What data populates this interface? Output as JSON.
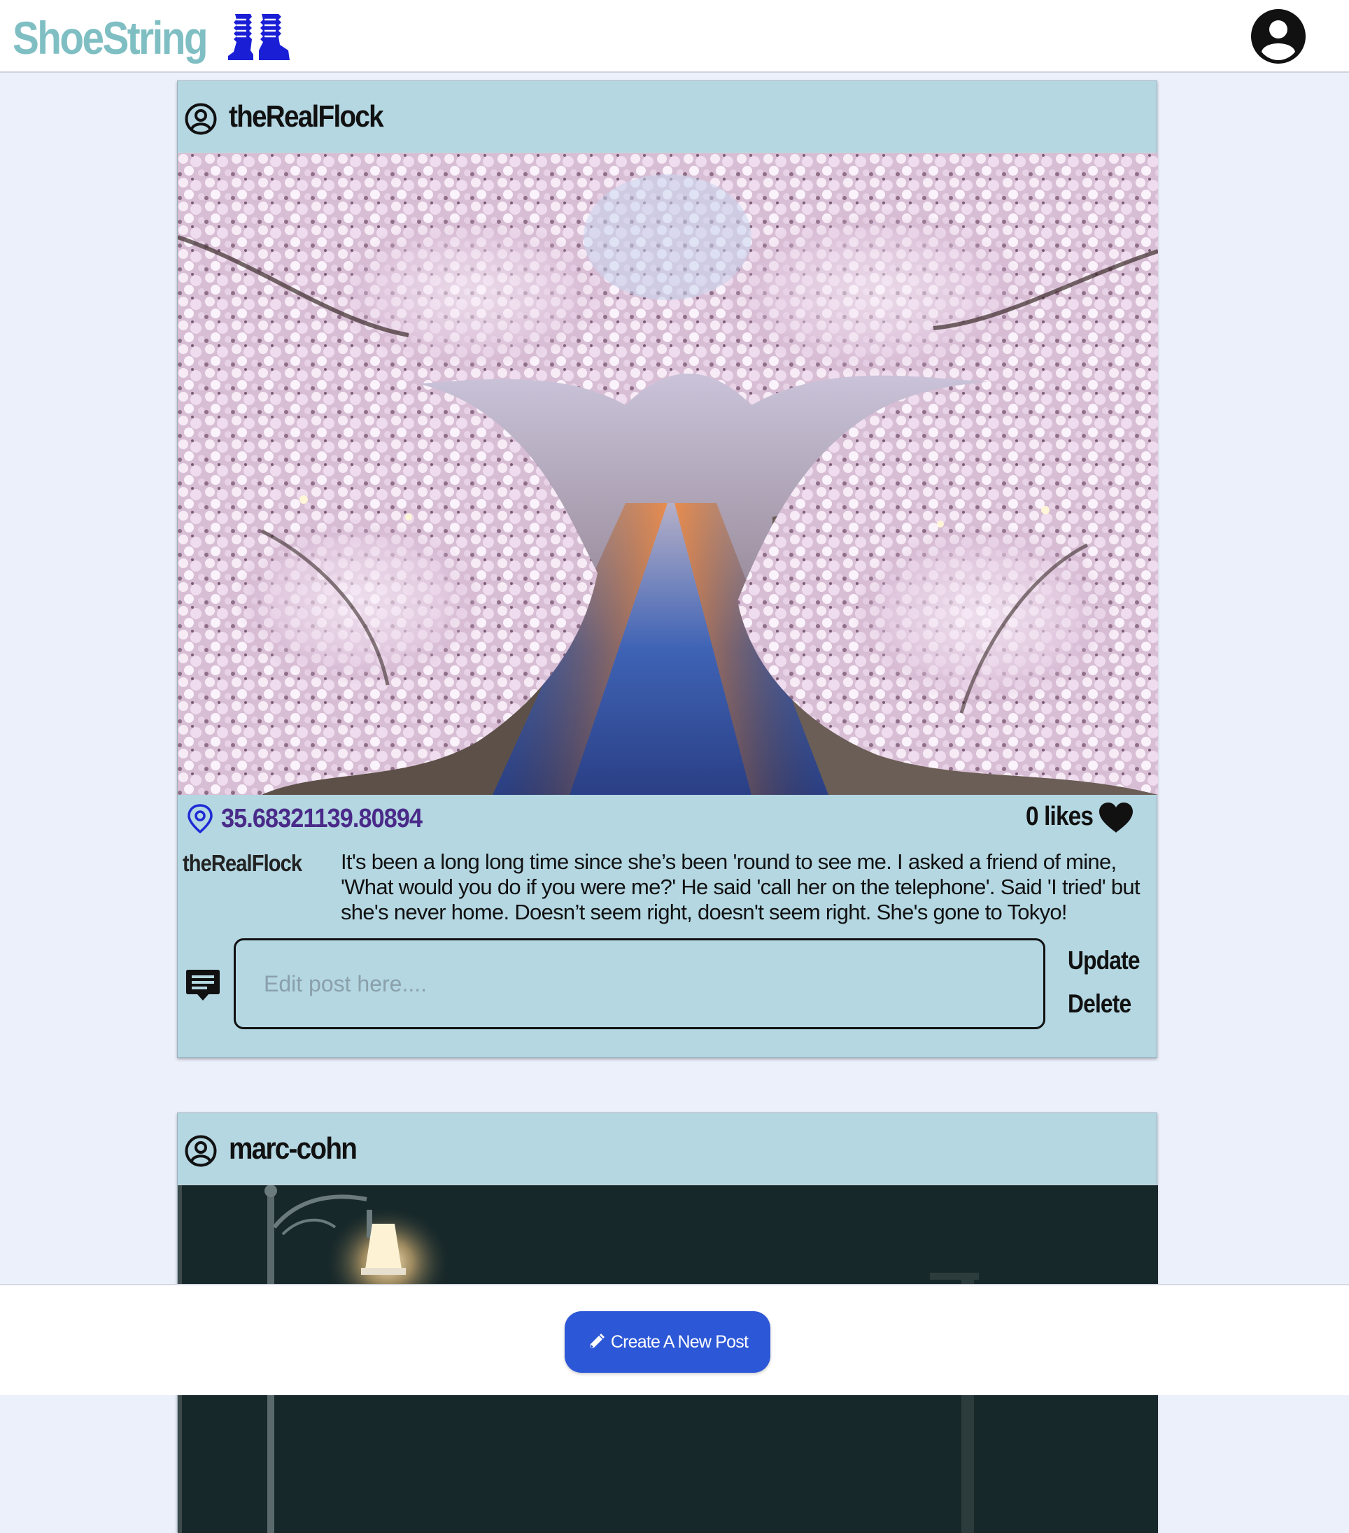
{
  "app": {
    "brand_name": "ShoeString",
    "brand_color": "#7fbfc3",
    "logo_icon": "boots-icon",
    "profile_icon": "account-circle-icon"
  },
  "posts": [
    {
      "username": "theRealFlock",
      "image_description_icon": "photo-cherry-blossom-canal",
      "location": "35.68321139.80894",
      "likes_label": "0 likes",
      "caption_user": "theRealFlock",
      "caption": "It's been a long long time since she’s been 'round to see me. I asked a friend of mine, 'What would you do if you were me?' He said 'call her on the telephone'. Said 'I tried' but she's never home. Doesn’t seem right, doesn't seem right. She's gone to Tokyo!",
      "edit_placeholder": "Edit post here....",
      "update_label": "Update",
      "delete_label": "Delete"
    },
    {
      "username": "marc-cohn",
      "image_description_icon": "photo-night-street-lamp"
    }
  ],
  "footer": {
    "create_label": "Create A New Post",
    "create_icon": "pencil-icon",
    "button_color": "#2c57d6"
  },
  "colors": {
    "page_background": "#ecf0fb",
    "card_background": "#b4d7e2",
    "location_text": "#4a2a88",
    "pin_icon": "#1f2ad6",
    "logo": "#1a1fd6"
  }
}
